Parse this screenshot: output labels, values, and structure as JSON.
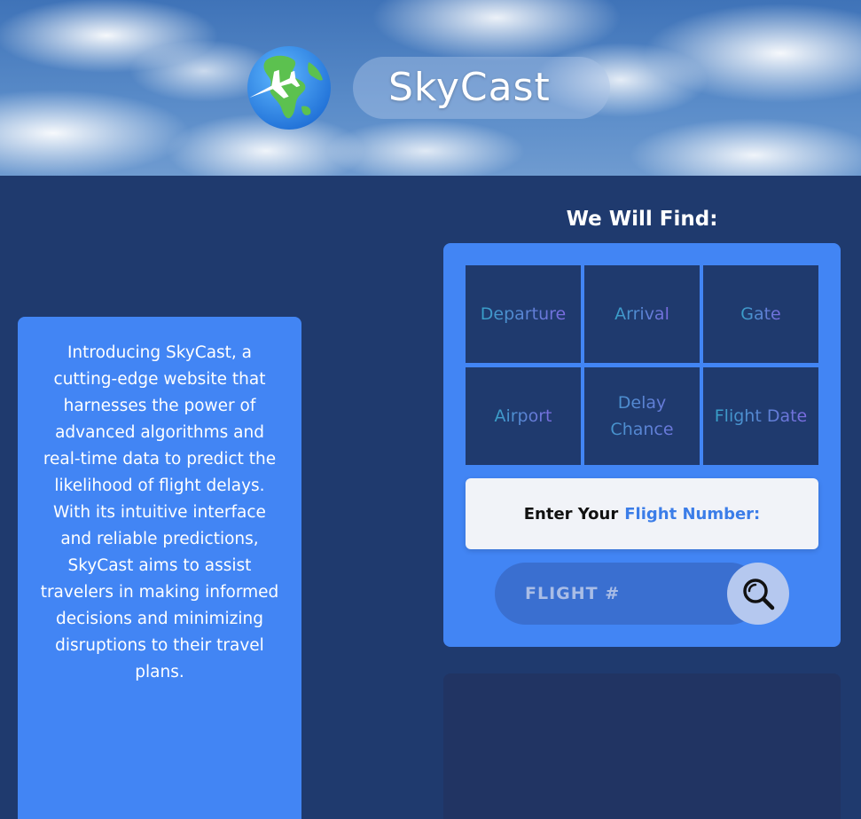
{
  "header": {
    "brand": "SkyCast",
    "logo_icon": "globe-with-airplane-icon"
  },
  "intro": {
    "text": "Introducing SkyCast, a cutting-edge website that harnesses the power of advanced algorithms and real-time data to predict the likelihood of flight delays. With its intuitive interface and reliable predictions, SkyCast aims to assist travelers in making informed decisions and minimizing disruptions to their travel plans."
  },
  "find": {
    "heading": "We Will Find:",
    "items": [
      {
        "label": "Departure"
      },
      {
        "label": "Arrival"
      },
      {
        "label": "Gate"
      },
      {
        "label": "Airport"
      },
      {
        "label": "Delay Chance"
      },
      {
        "label": "Flight Date"
      }
    ]
  },
  "prompt": {
    "lead": "Enter Your",
    "accent": "Flight Number:"
  },
  "search": {
    "placeholder": "FLIGHT #",
    "icon": "search-icon"
  },
  "colors": {
    "page_bg": "#1f3a6e",
    "panel_bg": "#4285f4",
    "accent_text": "#3b7de8",
    "feature_gradient_start": "#37a0c8",
    "feature_gradient_end": "#7b6be0"
  }
}
